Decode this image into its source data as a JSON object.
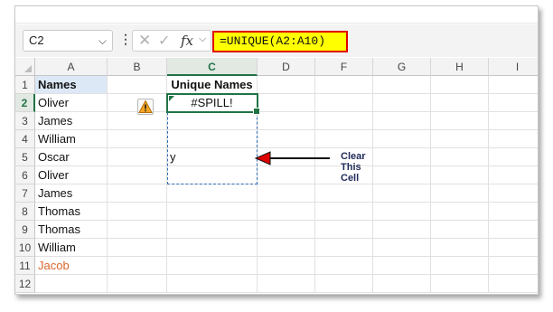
{
  "name_box": {
    "value": "C2"
  },
  "formula_bar": {
    "formula": "=UNIQUE(A2:A10)",
    "fx_label": "fx"
  },
  "columns": [
    "A",
    "B",
    "C",
    "D",
    "F",
    "G",
    "H",
    "I"
  ],
  "rows": [
    "1",
    "2",
    "3",
    "4",
    "5",
    "6",
    "7",
    "8",
    "9",
    "10",
    "11",
    "12"
  ],
  "column_a": [
    "Names",
    "Oliver",
    "James",
    "William",
    "Oscar",
    "Oliver",
    "James",
    "Thomas",
    "Thomas",
    "William",
    "Jacob",
    ""
  ],
  "column_c": {
    "header": "Unique Names",
    "spill_error": "#SPILL!",
    "blocking_value": "y"
  },
  "annotation": {
    "label": "Clear This Cell"
  },
  "colors": {
    "formula_highlight": "#ffff00",
    "formula_border": "#e00000",
    "active_cell": "#217346",
    "arrow": "#e00000",
    "orange_text": "#d9662a"
  },
  "icons": [
    "chevron-down-icon",
    "more-options-icon",
    "cancel-icon",
    "enter-icon",
    "insert-function-icon",
    "warning-icon",
    "select-all-icon"
  ]
}
